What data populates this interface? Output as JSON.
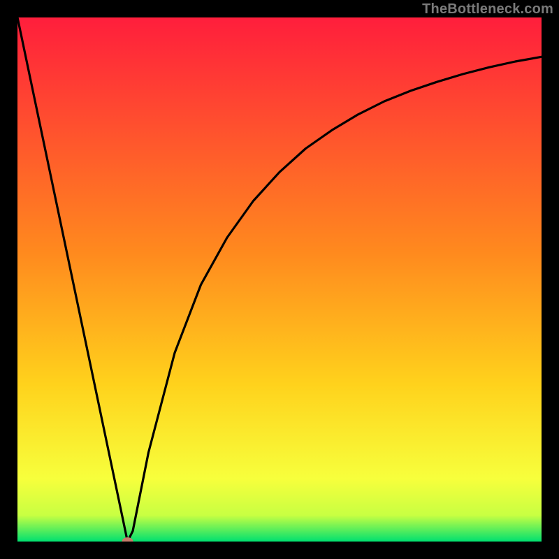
{
  "watermark": "TheBottleneck.com",
  "colors": {
    "top": "#ff1e3c",
    "mid": "#ffd21c",
    "bottom_band": "#c8ff42",
    "green": "#00e070",
    "frame": "#000000",
    "curve": "#000000",
    "marker": "#c77c6a"
  },
  "chart_data": {
    "type": "line",
    "title": "",
    "xlabel": "",
    "ylabel": "",
    "xlim": [
      0,
      100
    ],
    "ylim": [
      0,
      100
    ],
    "x": [
      0,
      5,
      10,
      15,
      20,
      21,
      22,
      25,
      30,
      35,
      40,
      45,
      50,
      55,
      60,
      65,
      70,
      75,
      80,
      85,
      90,
      95,
      100
    ],
    "y": [
      100,
      76.2,
      52.4,
      28.6,
      4.8,
      0,
      2,
      17,
      36,
      49,
      58,
      65,
      70.5,
      75,
      78.5,
      81.5,
      84,
      86,
      87.7,
      89.2,
      90.5,
      91.6,
      92.5
    ],
    "marker": {
      "x": 21,
      "y": 0
    },
    "annotations": []
  }
}
